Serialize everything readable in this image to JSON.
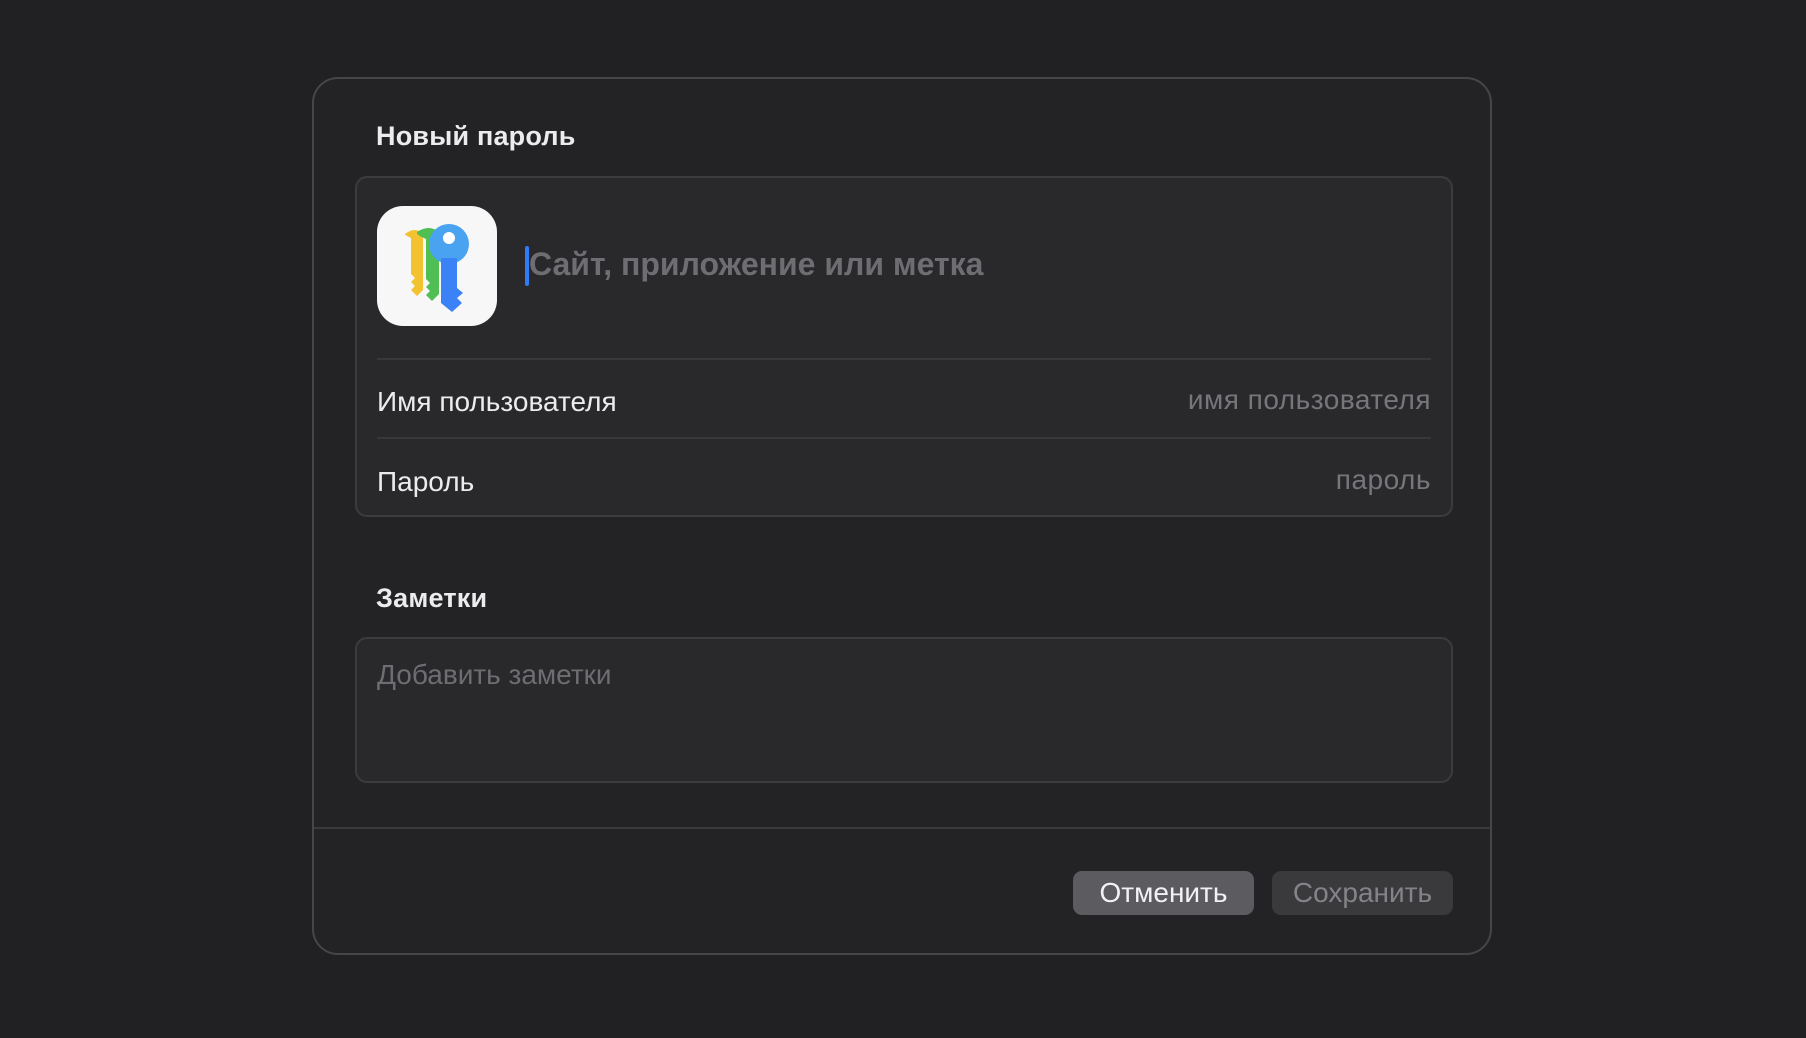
{
  "dialog": {
    "title": "Новый пароль",
    "site": {
      "value": "",
      "placeholder": "Сайт, приложение или метка",
      "icon": "passwords-app-keys-icon"
    },
    "username": {
      "label": "Имя пользователя",
      "value": "",
      "placeholder": "имя пользователя"
    },
    "password": {
      "label": "Пароль",
      "value": "",
      "placeholder": "пароль"
    },
    "notes": {
      "title": "Заметки",
      "value": "",
      "placeholder": "Добавить заметки"
    },
    "buttons": {
      "cancel": "Отменить",
      "save": "Сохранить",
      "save_enabled": false
    }
  },
  "colors": {
    "background": "#212124",
    "accent_caret": "#2f7cf6",
    "key_yellow": "#f2c230",
    "key_green": "#4fbf54",
    "key_blue": "#3b82f6"
  }
}
